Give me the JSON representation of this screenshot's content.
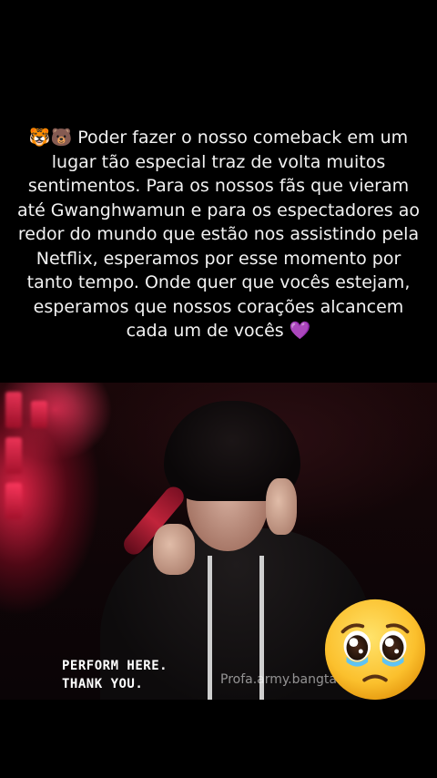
{
  "caption": {
    "emojis": "🐯🐻",
    "text": "Poder fazer o nosso comeback em um lugar tão especial traz de volta muitos sentimentos. Para os nossos fãs que vieram até Gwanghwamun e para os espectadores ao redor do mundo que estão nos assistindo pela Netflix, esperamos por esse momento por tanto tempo. Onde quer que vocês estejam, esperamos que nossos corações alcancem cada um de vocês",
    "end_emoji": "💜"
  },
  "video": {
    "subtitle_line1": "PERFORM HERE.",
    "subtitle_line2": "THANK YOU.",
    "watermark": "Profa.army.bangta"
  },
  "sticker": {
    "icon": "pleading-face-emoji"
  }
}
